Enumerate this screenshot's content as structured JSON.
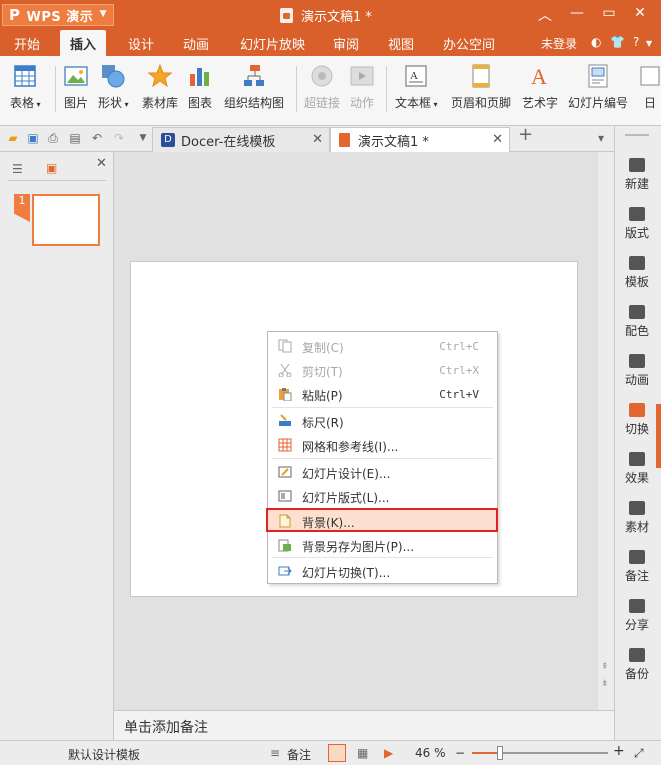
{
  "title_bar": {
    "app_label": "WPS 演示",
    "app_glyph": "P",
    "document_title": "演示文稿1 *",
    "controls": [
      "minimize-icon",
      "restore-icon",
      "close-icon"
    ]
  },
  "menu": {
    "items": [
      "开始",
      "插入",
      "设计",
      "动画",
      "幻灯片放映",
      "审阅",
      "视图",
      "办公空间"
    ],
    "active": "插入",
    "login": "未登录",
    "help": "?"
  },
  "ribbon": {
    "buttons": [
      {
        "label": "表格",
        "icon": "table-icon",
        "dropdown": true
      },
      {
        "label": "图片",
        "icon": "picture-icon"
      },
      {
        "label": "形状",
        "icon": "shapes-icon",
        "dropdown": true
      },
      {
        "label": "素材库",
        "icon": "star-icon"
      },
      {
        "label": "图表",
        "icon": "chart-icon"
      },
      {
        "label": "组织结构图",
        "icon": "org-chart-icon"
      },
      {
        "label": "超链接",
        "icon": "hyperlink-icon",
        "disabled": true
      },
      {
        "label": "动作",
        "icon": "action-icon",
        "disabled": true
      },
      {
        "label": "文本框",
        "icon": "textbox-icon",
        "dropdown": true
      },
      {
        "label": "页眉和页脚",
        "icon": "header-footer-icon"
      },
      {
        "label": "艺术字",
        "icon": "wordart-icon"
      },
      {
        "label": "幻灯片编号",
        "icon": "slide-number-icon"
      },
      {
        "label": "日",
        "icon": "date-icon"
      }
    ]
  },
  "tabs": [
    {
      "label": "Docer-在线模板",
      "active": false
    },
    {
      "label": "演示文稿1 *",
      "active": true
    }
  ],
  "context_menu": {
    "items": [
      {
        "label": "复制(C)",
        "shortcut": "Ctrl+C",
        "disabled": true,
        "icon": "copy-icon"
      },
      {
        "label": "剪切(T)",
        "shortcut": "Ctrl+X",
        "disabled": true,
        "icon": "cut-icon"
      },
      {
        "label": "粘贴(P)",
        "shortcut": "Ctrl+V",
        "disabled": false,
        "icon": "paste-icon"
      },
      {
        "label": "标尺(R)",
        "shortcut": "",
        "disabled": false,
        "icon": "ruler-icon"
      },
      {
        "label": "网格和参考线(I)...",
        "shortcut": "",
        "disabled": false,
        "icon": "grid-icon"
      },
      {
        "label": "幻灯片设计(E)...",
        "shortcut": "",
        "disabled": false,
        "icon": "slide-design-icon"
      },
      {
        "label": "幻灯片版式(L)...",
        "shortcut": "",
        "disabled": false,
        "icon": "slide-layout-icon"
      },
      {
        "label": "背景(K)...",
        "shortcut": "",
        "disabled": false,
        "highlighted": true,
        "icon": "background-icon"
      },
      {
        "label": "背景另存为图片(P)...",
        "shortcut": "",
        "disabled": false,
        "icon": "save-background-icon"
      },
      {
        "label": "幻灯片切换(T)...",
        "shortcut": "",
        "disabled": false,
        "icon": "slide-transition-icon"
      }
    ]
  },
  "notes_placeholder": "单击添加备注",
  "right_panel": {
    "items": [
      "新建",
      "版式",
      "模板",
      "配色",
      "动画",
      "切换",
      "效果",
      "素材",
      "备注",
      "分享",
      "备份"
    ]
  },
  "status_bar": {
    "template": "默认设计模板",
    "notes_label": "备注",
    "zoom_value": "46 %",
    "zoom_minus": "−",
    "zoom_plus": "+"
  },
  "slide_panel": {
    "slide_number": "1"
  },
  "colors": {
    "accent": "#d9602a",
    "highlight_border": "#e32222",
    "highlight_fill": "#fde0d0"
  }
}
